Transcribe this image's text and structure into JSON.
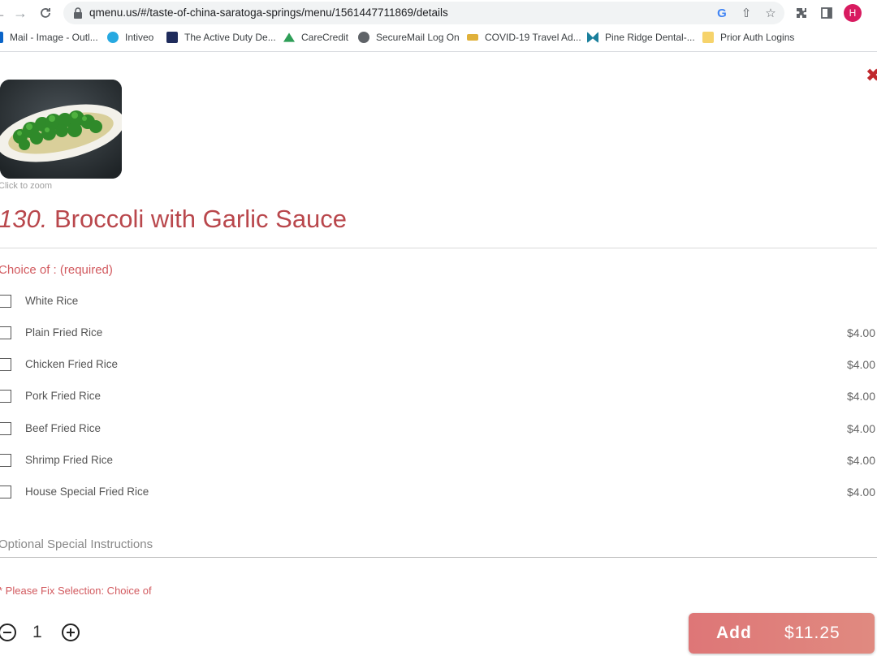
{
  "browser": {
    "url": "qmenu.us/#/taste-of-china-saratoga-springs/menu/1561447711869/details",
    "profile_initial": "H",
    "bookmarks": [
      {
        "label": "Mail - Image - Outl...",
        "icon": "outlook-icon",
        "color": "#0a64c8"
      },
      {
        "label": "Intiveo",
        "icon": "intiveo-icon",
        "color": "#27a9e1"
      },
      {
        "label": "The Active Duty De...",
        "icon": "active-duty-icon",
        "color": "#1f2c5c"
      },
      {
        "label": "CareCredit",
        "icon": "carecredit-icon",
        "color": "#2e9e57"
      },
      {
        "label": "SecureMail Log On",
        "icon": "globe-icon",
        "color": "#5f6368"
      },
      {
        "label": "COVID-19 Travel Ad...",
        "icon": "plane-icon",
        "color": "#e0b13a"
      },
      {
        "label": "Pine Ridge Dental-...",
        "icon": "pine-ridge-icon",
        "color": "#1a7f9c"
      },
      {
        "label": "Prior Auth Logins",
        "icon": "folder-icon",
        "color": "#f6d36b"
      }
    ]
  },
  "dish": {
    "zoom_hint": "Click to zoom",
    "number": "130.",
    "name": "Broccoli with Garlic Sauce",
    "choice_heading": "Choice of : (required)",
    "options": [
      {
        "label": "White Rice",
        "price": ""
      },
      {
        "label": "Plain Fried Rice",
        "price": "$4.00"
      },
      {
        "label": "Chicken Fried Rice",
        "price": "$4.00"
      },
      {
        "label": "Pork Fried Rice",
        "price": "$4.00"
      },
      {
        "label": "Beef Fried Rice",
        "price": "$4.00"
      },
      {
        "label": "Shrimp Fried Rice",
        "price": "$4.00"
      },
      {
        "label": "House Special Fried Rice",
        "price": "$4.00"
      }
    ],
    "instructions_placeholder": "Optional Special Instructions",
    "fix_message": "* Please Fix Selection: Choice of",
    "quantity": "1",
    "add_label": "Add",
    "total": "$11.25"
  },
  "colors": {
    "accent": "#b9474c",
    "add_button": "#de7677"
  }
}
